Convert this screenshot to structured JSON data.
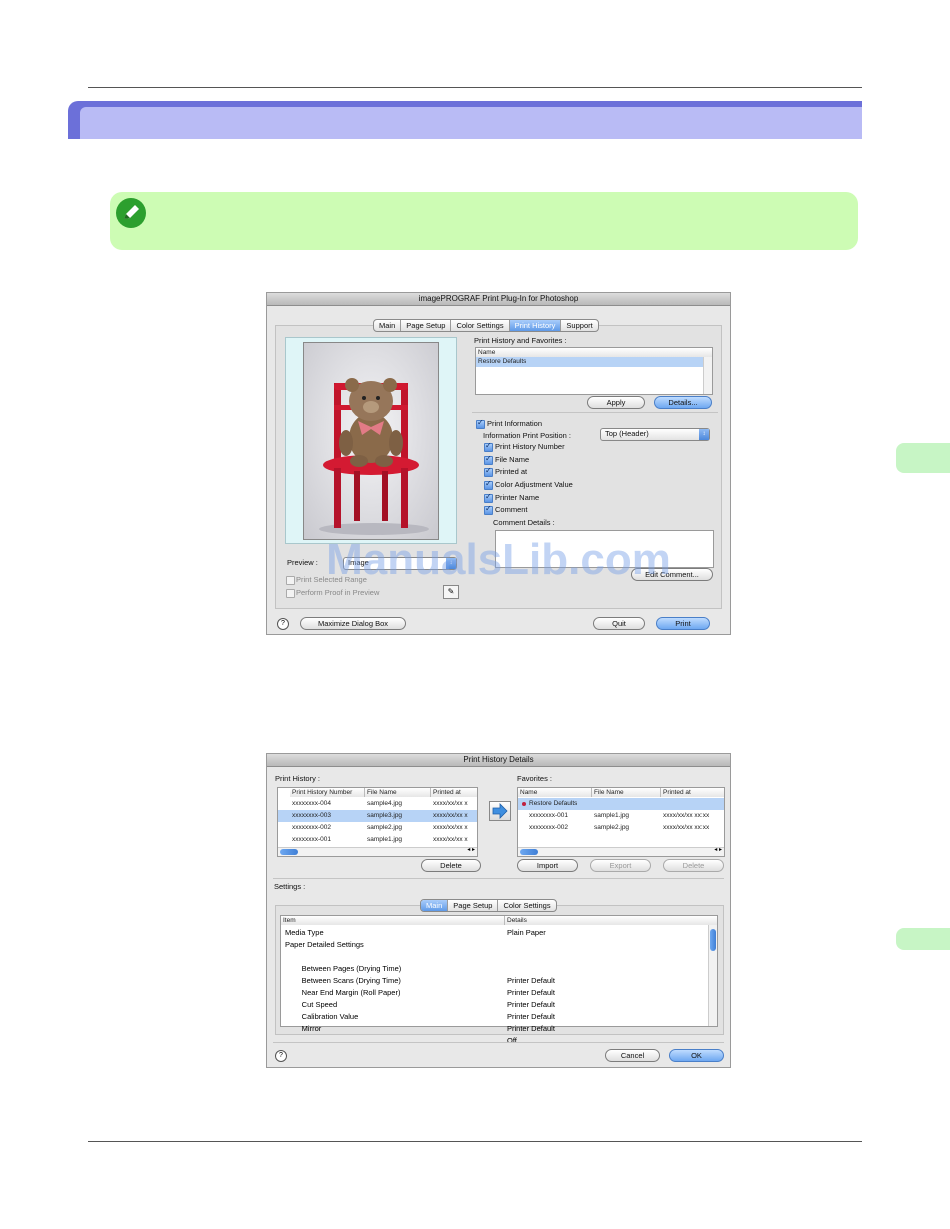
{
  "plugin_dialog": {
    "title": "imagePROGRAF Print Plug-In for Photoshop",
    "tabs": [
      "Main",
      "Page Setup",
      "Color Settings",
      "Print History",
      "Support"
    ],
    "selected_tab": "Print History",
    "print_history_favorites_label": "Print History and Favorites :",
    "name_column": "Name",
    "list_items": [
      "Restore Defaults"
    ],
    "apply_button": "Apply",
    "details_button": "Details...",
    "print_information_label": "Print Information",
    "info_position_label": "Information Print Position :",
    "info_position_value": "Top (Header)",
    "options": [
      "Print History Number",
      "File Name",
      "Printed at",
      "Color Adjustment Value",
      "Printer Name",
      "Comment"
    ],
    "comment_details_label": "Comment Details :",
    "edit_comment_button": "Edit Comment...",
    "preview_label": "Preview :",
    "preview_value": "Image",
    "print_selected_range": "Print Selected Range",
    "perform_proof": "Perform Proof in Preview",
    "maximize_button": "Maximize Dialog Box",
    "quit_button": "Quit",
    "print_button": "Print",
    "help_icon": "?"
  },
  "details_dialog": {
    "title": "Print History Details",
    "print_history_label": "Print History :",
    "favorites_label": "Favorites :",
    "history_columns": [
      "Print History Number",
      "File Name",
      "Printed at"
    ],
    "history_rows": [
      [
        "xxxxxxxx-004",
        "sample4.jpg",
        "xxxx/xx/xx x"
      ],
      [
        "xxxxxxxx-003",
        "sample3.jpg",
        "xxxx/xx/xx x"
      ],
      [
        "xxxxxxxx-002",
        "sample2.jpg",
        "xxxx/xx/xx x"
      ],
      [
        "xxxxxxxx-001",
        "sample1.jpg",
        "xxxx/xx/xx x"
      ]
    ],
    "favorites_columns": [
      "Name",
      "File Name",
      "Printed at"
    ],
    "favorites_rows": [
      [
        "Restore Defaults",
        "",
        ""
      ],
      [
        "xxxxxxxx-001",
        "sample1.jpg",
        "xxxx/xx/xx xx:xx"
      ],
      [
        "xxxxxxxx-002",
        "sample2.jpg",
        "xxxx/xx/xx xx:xx"
      ]
    ],
    "delete_button": "Delete",
    "import_button": "Import",
    "export_button": "Export",
    "fav_delete_button": "Delete",
    "settings_label": "Settings :",
    "settings_tabs": [
      "Main",
      "Page Setup",
      "Color Settings"
    ],
    "settings_selected_tab": "Main",
    "settings_columns": [
      "Item",
      "Details"
    ],
    "settings_rows": [
      [
        "Media Type",
        "Plain Paper"
      ],
      [
        "Paper Detailed Settings",
        ""
      ],
      [
        "  Between Pages (Drying Time)",
        "Printer Default"
      ],
      [
        "  Between Scans (Drying Time)",
        "Printer Default"
      ],
      [
        "  Near End Margin (Roll Paper)",
        "Printer Default"
      ],
      [
        "  Cut Speed",
        "Printer Default"
      ],
      [
        "  Calibration Value",
        "Printer Default"
      ],
      [
        "  Mirror",
        "Off"
      ]
    ],
    "cancel_button": "Cancel",
    "ok_button": "OK",
    "help_icon": "?"
  },
  "watermark": "ManualsLib.com"
}
